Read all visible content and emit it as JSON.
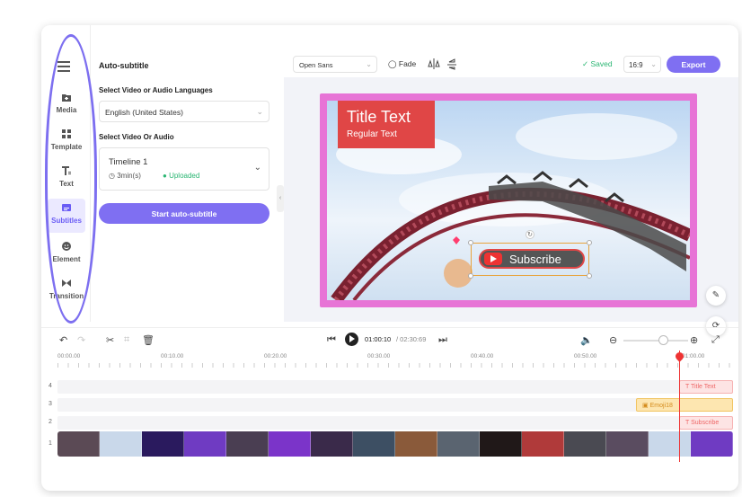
{
  "sidebar": {
    "items": [
      {
        "label": "Media",
        "icon": "media-icon"
      },
      {
        "label": "Template",
        "icon": "template-icon"
      },
      {
        "label": "Text",
        "icon": "text-icon"
      },
      {
        "label": "Subtitles",
        "icon": "subtitles-icon",
        "active": true
      },
      {
        "label": "Element",
        "icon": "element-icon"
      },
      {
        "label": "Transition",
        "icon": "transition-icon"
      }
    ]
  },
  "panel": {
    "title": "Auto-subtitle",
    "language_label": "Select Video or Audio Languages",
    "language_value": "English (United States)",
    "source_label": "Select Video Or Audio",
    "timeline_name": "Timeline 1",
    "timeline_duration": "3min(s)",
    "timeline_status": "Uploaded",
    "start_button": "Start auto-subtitle"
  },
  "toolbar": {
    "font": "Open Sans",
    "fade": "Fade",
    "saved": "Saved",
    "ratio": "16:9",
    "export": "Export"
  },
  "canvas": {
    "title_text": "Title Text",
    "regular_text": "Regular Text",
    "subscribe_text": "Subscribe"
  },
  "playback": {
    "current_time": "01:00:10",
    "total_time": "/ 02:30:69"
  },
  "ruler": {
    "labels": [
      "00:00.00",
      "00:10.00",
      "00:20.00",
      "00:30.00",
      "00:40.00",
      "00:50.00",
      "01:00.00"
    ]
  },
  "tracks": {
    "numbers": [
      "4",
      "3",
      "2",
      "1"
    ],
    "title_clip": "Title Text",
    "emoji_clip": "Emoji18",
    "subtitle_clip": "Subscribe"
  },
  "colors": {
    "accent": "#7f6ff2",
    "saved_green": "#2bb673",
    "playhead_red": "#e33333",
    "canvas_border": "#e774d6"
  }
}
